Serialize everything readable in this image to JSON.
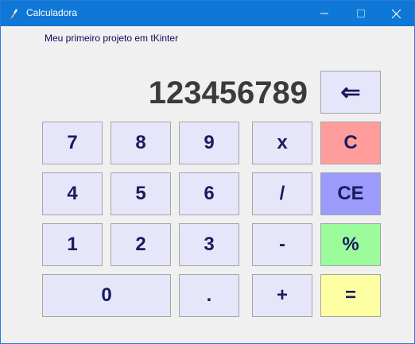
{
  "window": {
    "title": "Calculadora"
  },
  "subtitle": "Meu primeiro projeto em tKinter",
  "display": "123456789",
  "keys": {
    "backspace": "⇐",
    "k7": "7",
    "k8": "8",
    "k9": "9",
    "mul": "x",
    "clear": "C",
    "k4": "4",
    "k5": "5",
    "k6": "6",
    "div": "/",
    "clear_entry": "CE",
    "k1": "1",
    "k2": "2",
    "k3": "3",
    "sub": "-",
    "percent": "%",
    "k0": "0",
    "dot": ".",
    "add": "+",
    "equals": "="
  },
  "colors": {
    "clear": "#ff9c9c",
    "clear_entry": "#9b9bfb",
    "percent": "#9cfc9c",
    "equals": "#fefea2",
    "key_default": "#e6e6fa"
  }
}
